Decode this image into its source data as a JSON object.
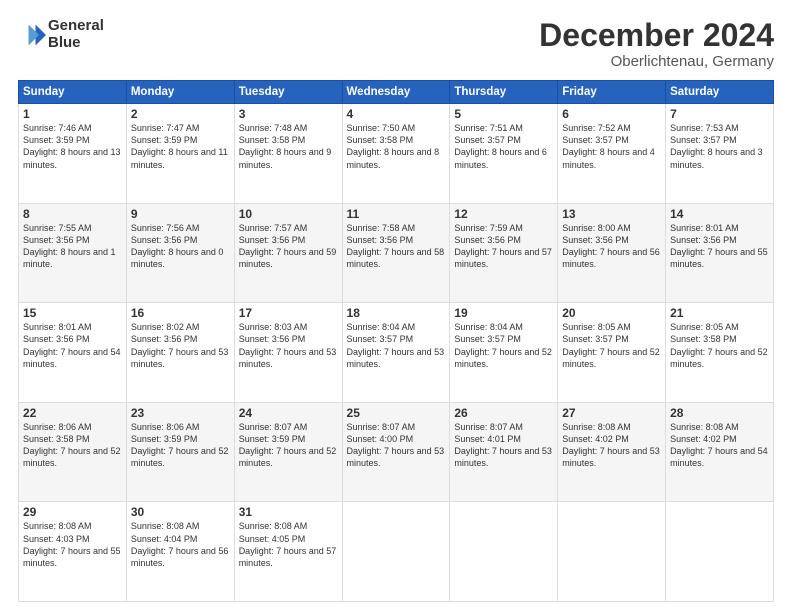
{
  "header": {
    "logo_line1": "General",
    "logo_line2": "Blue",
    "title": "December 2024",
    "subtitle": "Oberlichtenau, Germany"
  },
  "calendar": {
    "headers": [
      "Sunday",
      "Monday",
      "Tuesday",
      "Wednesday",
      "Thursday",
      "Friday",
      "Saturday"
    ],
    "rows": [
      [
        {
          "day": "1",
          "detail": "Sunrise: 7:46 AM\nSunset: 3:59 PM\nDaylight: 8 hours\nand 13 minutes."
        },
        {
          "day": "2",
          "detail": "Sunrise: 7:47 AM\nSunset: 3:59 PM\nDaylight: 8 hours\nand 11 minutes."
        },
        {
          "day": "3",
          "detail": "Sunrise: 7:48 AM\nSunset: 3:58 PM\nDaylight: 8 hours\nand 9 minutes."
        },
        {
          "day": "4",
          "detail": "Sunrise: 7:50 AM\nSunset: 3:58 PM\nDaylight: 8 hours\nand 8 minutes."
        },
        {
          "day": "5",
          "detail": "Sunrise: 7:51 AM\nSunset: 3:57 PM\nDaylight: 8 hours\nand 6 minutes."
        },
        {
          "day": "6",
          "detail": "Sunrise: 7:52 AM\nSunset: 3:57 PM\nDaylight: 8 hours\nand 4 minutes."
        },
        {
          "day": "7",
          "detail": "Sunrise: 7:53 AM\nSunset: 3:57 PM\nDaylight: 8 hours\nand 3 minutes."
        }
      ],
      [
        {
          "day": "8",
          "detail": "Sunrise: 7:55 AM\nSunset: 3:56 PM\nDaylight: 8 hours\nand 1 minute."
        },
        {
          "day": "9",
          "detail": "Sunrise: 7:56 AM\nSunset: 3:56 PM\nDaylight: 8 hours\nand 0 minutes."
        },
        {
          "day": "10",
          "detail": "Sunrise: 7:57 AM\nSunset: 3:56 PM\nDaylight: 7 hours\nand 59 minutes."
        },
        {
          "day": "11",
          "detail": "Sunrise: 7:58 AM\nSunset: 3:56 PM\nDaylight: 7 hours\nand 58 minutes."
        },
        {
          "day": "12",
          "detail": "Sunrise: 7:59 AM\nSunset: 3:56 PM\nDaylight: 7 hours\nand 57 minutes."
        },
        {
          "day": "13",
          "detail": "Sunrise: 8:00 AM\nSunset: 3:56 PM\nDaylight: 7 hours\nand 56 minutes."
        },
        {
          "day": "14",
          "detail": "Sunrise: 8:01 AM\nSunset: 3:56 PM\nDaylight: 7 hours\nand 55 minutes."
        }
      ],
      [
        {
          "day": "15",
          "detail": "Sunrise: 8:01 AM\nSunset: 3:56 PM\nDaylight: 7 hours\nand 54 minutes."
        },
        {
          "day": "16",
          "detail": "Sunrise: 8:02 AM\nSunset: 3:56 PM\nDaylight: 7 hours\nand 53 minutes."
        },
        {
          "day": "17",
          "detail": "Sunrise: 8:03 AM\nSunset: 3:56 PM\nDaylight: 7 hours\nand 53 minutes."
        },
        {
          "day": "18",
          "detail": "Sunrise: 8:04 AM\nSunset: 3:57 PM\nDaylight: 7 hours\nand 53 minutes."
        },
        {
          "day": "19",
          "detail": "Sunrise: 8:04 AM\nSunset: 3:57 PM\nDaylight: 7 hours\nand 52 minutes."
        },
        {
          "day": "20",
          "detail": "Sunrise: 8:05 AM\nSunset: 3:57 PM\nDaylight: 7 hours\nand 52 minutes."
        },
        {
          "day": "21",
          "detail": "Sunrise: 8:05 AM\nSunset: 3:58 PM\nDaylight: 7 hours\nand 52 minutes."
        }
      ],
      [
        {
          "day": "22",
          "detail": "Sunrise: 8:06 AM\nSunset: 3:58 PM\nDaylight: 7 hours\nand 52 minutes."
        },
        {
          "day": "23",
          "detail": "Sunrise: 8:06 AM\nSunset: 3:59 PM\nDaylight: 7 hours\nand 52 minutes."
        },
        {
          "day": "24",
          "detail": "Sunrise: 8:07 AM\nSunset: 3:59 PM\nDaylight: 7 hours\nand 52 minutes."
        },
        {
          "day": "25",
          "detail": "Sunrise: 8:07 AM\nSunset: 4:00 PM\nDaylight: 7 hours\nand 53 minutes."
        },
        {
          "day": "26",
          "detail": "Sunrise: 8:07 AM\nSunset: 4:01 PM\nDaylight: 7 hours\nand 53 minutes."
        },
        {
          "day": "27",
          "detail": "Sunrise: 8:08 AM\nSunset: 4:02 PM\nDaylight: 7 hours\nand 53 minutes."
        },
        {
          "day": "28",
          "detail": "Sunrise: 8:08 AM\nSunset: 4:02 PM\nDaylight: 7 hours\nand 54 minutes."
        }
      ],
      [
        {
          "day": "29",
          "detail": "Sunrise: 8:08 AM\nSunset: 4:03 PM\nDaylight: 7 hours\nand 55 minutes."
        },
        {
          "day": "30",
          "detail": "Sunrise: 8:08 AM\nSunset: 4:04 PM\nDaylight: 7 hours\nand 56 minutes."
        },
        {
          "day": "31",
          "detail": "Sunrise: 8:08 AM\nSunset: 4:05 PM\nDaylight: 7 hours\nand 57 minutes."
        },
        {
          "day": "",
          "detail": ""
        },
        {
          "day": "",
          "detail": ""
        },
        {
          "day": "",
          "detail": ""
        },
        {
          "day": "",
          "detail": ""
        }
      ]
    ]
  }
}
